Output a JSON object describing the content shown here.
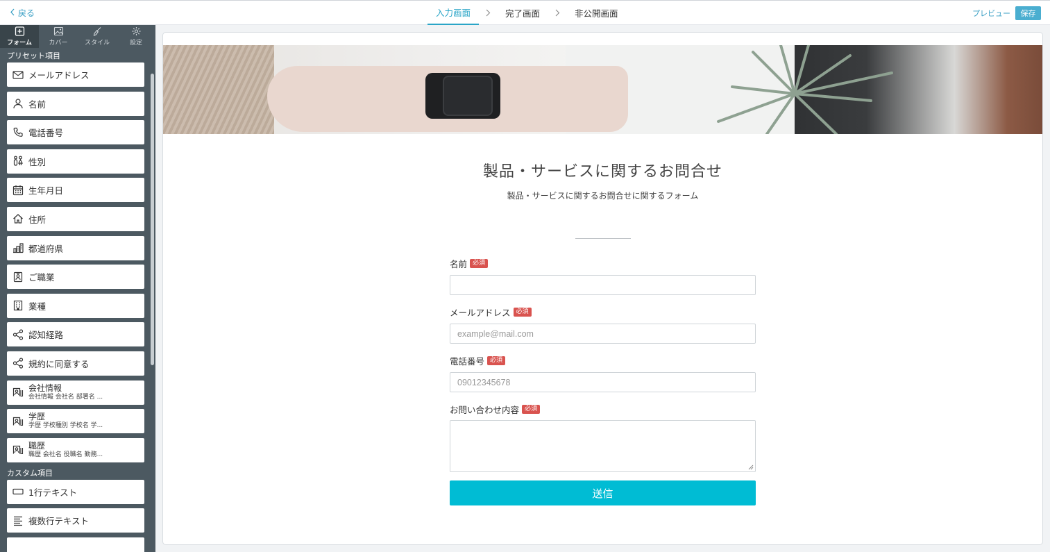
{
  "topbar": {
    "back_label": "戻る",
    "steps": [
      {
        "label": "入力画面",
        "active": true
      },
      {
        "label": "完了画面",
        "active": false
      },
      {
        "label": "非公開画面",
        "active": false
      }
    ],
    "preview_label": "プレビュー",
    "save_label": "保存",
    "accent_color": "#2aa5c7"
  },
  "sidebar": {
    "tabs": [
      {
        "label": "フォーム",
        "icon": "plus-square-icon",
        "active": true
      },
      {
        "label": "カバー",
        "icon": "image-icon",
        "active": false
      },
      {
        "label": "スタイル",
        "icon": "brush-icon",
        "active": false
      },
      {
        "label": "設定",
        "icon": "gear-icon",
        "active": false
      }
    ],
    "preset_heading": "プリセット項目",
    "preset_items": [
      {
        "label": "メールアドレス",
        "icon": "mail-icon"
      },
      {
        "label": "名前",
        "icon": "person-icon"
      },
      {
        "label": "電話番号",
        "icon": "phone-icon"
      },
      {
        "label": "性別",
        "icon": "gender-icon"
      },
      {
        "label": "生年月日",
        "icon": "calendar-icon"
      },
      {
        "label": "住所",
        "icon": "home-icon"
      },
      {
        "label": "都道府県",
        "icon": "city-icon"
      },
      {
        "label": "ご職業",
        "icon": "id-badge-icon"
      },
      {
        "label": "業種",
        "icon": "building-icon"
      },
      {
        "label": "認知経路",
        "icon": "share-icon"
      },
      {
        "label": "規約に同意する",
        "icon": "share-icon"
      },
      {
        "label": "会社情報",
        "sub": "会社情報 会社名 部署名 ...",
        "icon": "contact-card-icon"
      },
      {
        "label": "学歴",
        "sub": "学歴 学校種別 学校名 学...",
        "icon": "contact-card-icon"
      },
      {
        "label": "職歴",
        "sub": "職歴 会社名 役職名 勤務...",
        "icon": "contact-card-icon"
      }
    ],
    "custom_heading": "カスタム項目",
    "custom_items": [
      {
        "label": "1行テキスト",
        "icon": "input-box-icon"
      },
      {
        "label": "複数行テキスト",
        "icon": "multiline-text-icon"
      }
    ]
  },
  "form": {
    "title": "製品・サービスに関するお問合せ",
    "subtitle": "製品・サービスに関するお問合せに関するフォーム",
    "required_badge": "必須",
    "fields": [
      {
        "label": "名前",
        "placeholder": "",
        "type": "text"
      },
      {
        "label": "メールアドレス",
        "placeholder": "example@mail.com",
        "type": "text"
      },
      {
        "label": "電話番号",
        "placeholder": "09012345678",
        "type": "text"
      },
      {
        "label": "お問い合わせ内容",
        "placeholder": "",
        "type": "textarea"
      }
    ],
    "submit_label": "送信",
    "submit_color": "#00bcd4",
    "required_color": "#d9534f"
  }
}
